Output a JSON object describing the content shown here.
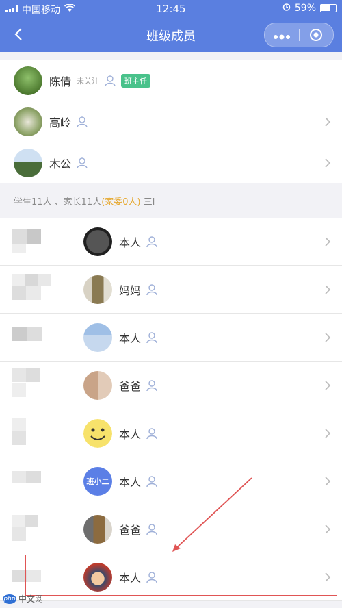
{
  "status_bar": {
    "carrier": "中国移动",
    "time": "12:45",
    "battery": "59%"
  },
  "nav": {
    "title": "班级成员",
    "more_icon": "more-dots-icon",
    "target_icon": "target-icon"
  },
  "teachers": [
    {
      "name": "陈倩",
      "follow": "未关注",
      "badge": "班主任"
    },
    {
      "name": "高岭"
    },
    {
      "name": "木公"
    }
  ],
  "summary": {
    "prefix": "学生11人 、家长11人",
    "committee": "(家委0人)",
    "suffix": "三l"
  },
  "members": [
    {
      "relation": "本人"
    },
    {
      "relation": "妈妈"
    },
    {
      "relation": "本人"
    },
    {
      "relation": "爸爸"
    },
    {
      "relation": "本人"
    },
    {
      "relation": "本人"
    },
    {
      "relation": "爸爸"
    },
    {
      "relation": "本人"
    }
  ],
  "avatar_text": "班小二",
  "watermark": {
    "logo": "php",
    "site": "中文网"
  },
  "colors": {
    "brand": "#5a7fe0",
    "badge": "#49c28b",
    "committee": "#e6a82e",
    "highlight": "#e05555"
  }
}
